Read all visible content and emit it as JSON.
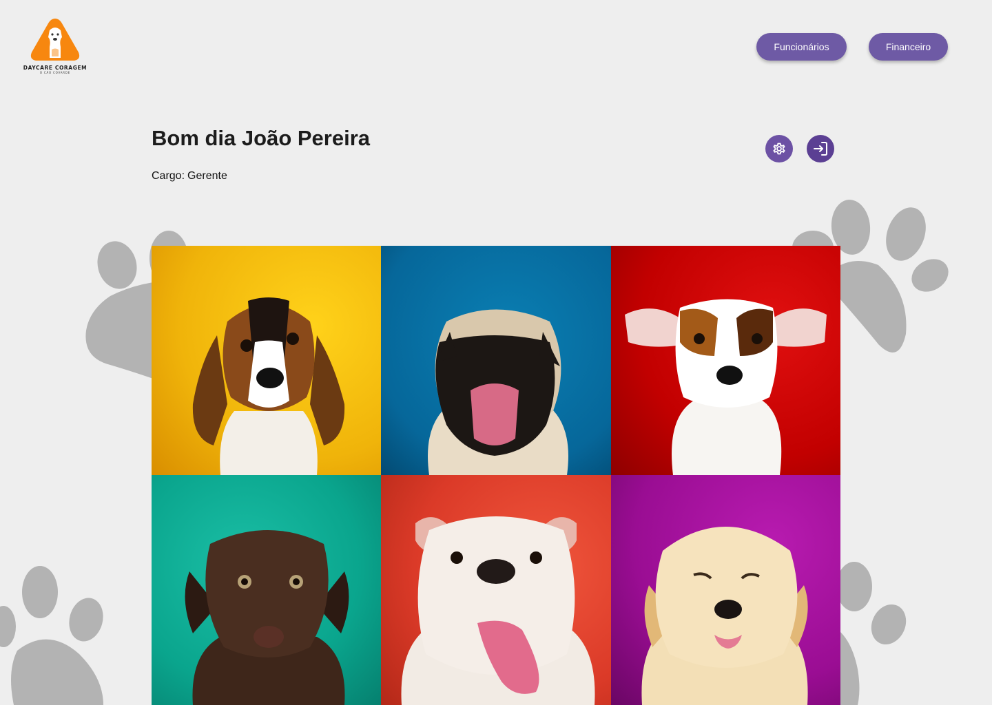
{
  "brand": {
    "name": "DAYCARE CORAGEM",
    "tagline": "O CÃO COVARDE"
  },
  "nav": {
    "items": [
      {
        "label": "Funcionários"
      },
      {
        "label": "Financeiro"
      }
    ]
  },
  "user": {
    "greeting": "Bom dia João Pereira",
    "role_label": "Cargo:",
    "role_value": "Gerente"
  },
  "actions": {
    "settings_icon": "gear-icon",
    "logout_icon": "logout-icon"
  },
  "gallery": {
    "tiles": [
      {
        "subject": "beagle-puppy",
        "background": "#f5c10f"
      },
      {
        "subject": "pug-puppy",
        "background": "#06679a"
      },
      {
        "subject": "jack-russell-puppy",
        "background": "#c20000"
      },
      {
        "subject": "chocolate-labrador-puppy",
        "background": "#0aa58d"
      },
      {
        "subject": "bulldog-puppy",
        "background": "#db3a28"
      },
      {
        "subject": "golden-retriever-puppy",
        "background": "#9a0d93"
      }
    ]
  },
  "colors": {
    "page_background": "#eeeeee",
    "accent": "#6e5aa5",
    "logo_orange": "#f7870f",
    "paw_gray": "#b3b3b3"
  }
}
